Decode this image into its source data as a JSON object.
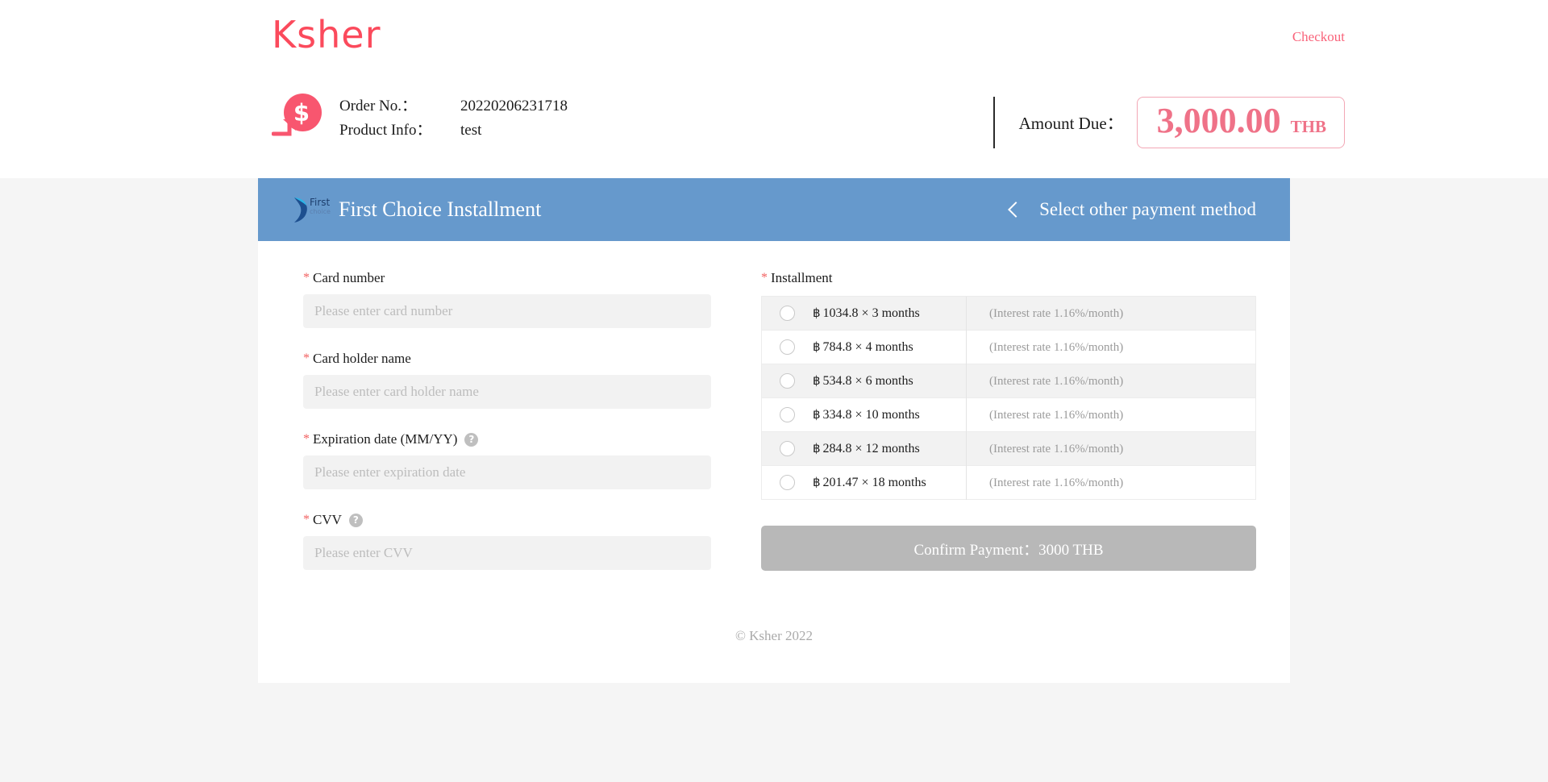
{
  "header": {
    "brand": "Ksher",
    "checkout_link": "Checkout"
  },
  "order": {
    "order_no_label": "Order No.：",
    "order_no_value": "20220206231718",
    "product_info_label": "Product Info：",
    "product_info_value": "test",
    "amount_due_label": "Amount Due：",
    "amount_value": "3,000.00",
    "amount_currency": "THB"
  },
  "payment_panel": {
    "logo_line1": "First",
    "logo_line2": "choice",
    "title": "First Choice Installment",
    "other_method": "Select other payment method"
  },
  "form": {
    "card_number": {
      "label": "Card number",
      "placeholder": "Please enter card number",
      "value": ""
    },
    "card_holder": {
      "label": "Card holder name",
      "placeholder": "Please enter card holder name",
      "value": ""
    },
    "expiration": {
      "label": "Expiration date (MM/YY)",
      "placeholder": "Please enter expiration date",
      "value": "",
      "help": "?"
    },
    "cvv": {
      "label": "CVV",
      "placeholder": "Please enter CVV",
      "value": "",
      "help": "?"
    }
  },
  "installment": {
    "label": "Installment",
    "baht_symbol": "฿",
    "options": [
      {
        "amount": "1034.8 × 3 months",
        "rate": "(Interest rate 1.16%/month)",
        "selected": false
      },
      {
        "amount": "784.8 × 4 months",
        "rate": "(Interest rate 1.16%/month)",
        "selected": false
      },
      {
        "amount": "534.8 × 6 months",
        "rate": "(Interest rate 1.16%/month)",
        "selected": false
      },
      {
        "amount": "334.8 × 10 months",
        "rate": "(Interest rate 1.16%/month)",
        "selected": false
      },
      {
        "amount": "284.8 × 12 months",
        "rate": "(Interest rate 1.16%/month)",
        "selected": false
      },
      {
        "amount": "201.47 × 18 months",
        "rate": "(Interest rate 1.16%/month)",
        "selected": false
      }
    ],
    "confirm_button": "Confirm Payment：3000 THB"
  },
  "footer": {
    "copyright": "© Ksher 2022"
  },
  "colors": {
    "brand_pink": "#fb4a5c",
    "amount_pink": "#ef7288",
    "panel_blue": "#6699cc",
    "page_bg": "#f5f5f5",
    "input_bg": "#f2f2f2",
    "disabled_button": "#b8b8b8"
  }
}
